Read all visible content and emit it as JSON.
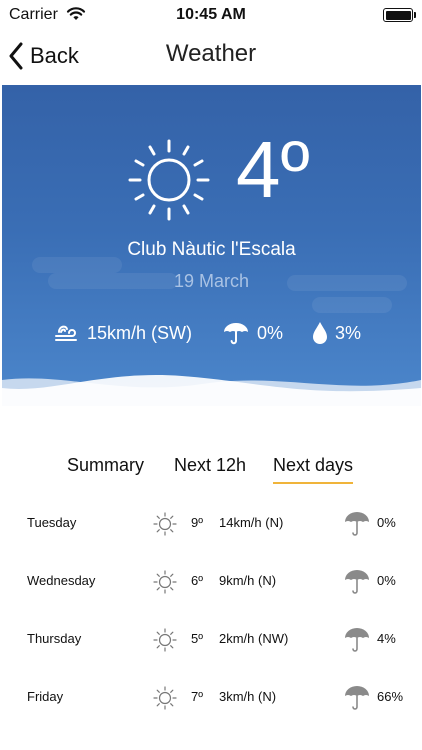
{
  "status_bar": {
    "carrier": "Carrier",
    "time": "10:45 AM"
  },
  "nav": {
    "back_label": "Back",
    "title": "Weather"
  },
  "current": {
    "temperature": "4º",
    "location": "Club Nàutic l'Escala",
    "date": "19 March",
    "wind": "15km/h (SW)",
    "rain_probability": "0%",
    "humidity": "3%"
  },
  "tabs": [
    {
      "label": "Summary",
      "active": false
    },
    {
      "label": "Next 12h",
      "active": false
    },
    {
      "label": "Next days",
      "active": true
    }
  ],
  "forecast": [
    {
      "day": "Tuesday",
      "temp": "9º",
      "wind": "14km/h (N)",
      "rain": "0%"
    },
    {
      "day": "Wednesday",
      "temp": "6º",
      "wind": "9km/h (N)",
      "rain": "0%"
    },
    {
      "day": "Thursday",
      "temp": "5º",
      "wind": "2km/h (NW)",
      "rain": "4%"
    },
    {
      "day": "Friday",
      "temp": "7º",
      "wind": "3km/h (N)",
      "rain": "66%"
    }
  ],
  "colors": {
    "hero_top": "#3462a8",
    "hero_bottom": "#4c87cc",
    "tab_underline": "#f0b43a",
    "forecast_icon": "#8a8a8a"
  }
}
